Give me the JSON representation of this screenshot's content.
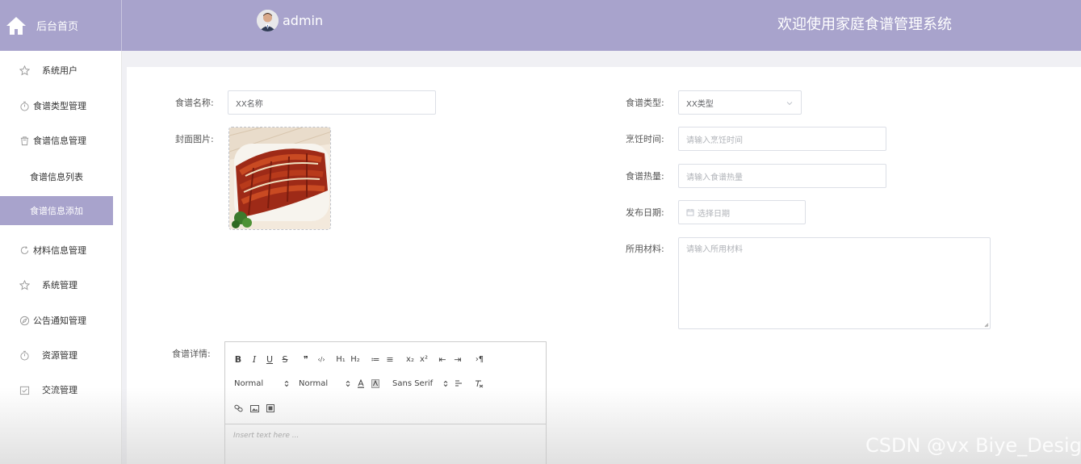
{
  "header": {
    "home_label": "后台首页",
    "username": "admin",
    "system_title": "欢迎使用家庭食谱管理系统"
  },
  "sidebar": {
    "items": [
      {
        "label": "系统用户",
        "icon": "star-icon"
      },
      {
        "label": "食谱类型管理",
        "icon": "timer-icon"
      },
      {
        "label": "食谱信息管理",
        "icon": "trash-icon"
      },
      {
        "label": "材料信息管理",
        "icon": "refresh-icon"
      },
      {
        "label": "系统管理",
        "icon": "star-icon"
      },
      {
        "label": "公告通知管理",
        "icon": "compass-icon"
      },
      {
        "label": "资源管理",
        "icon": "timer-icon"
      },
      {
        "label": "交流管理",
        "icon": "check-box-icon"
      }
    ],
    "sub_items": [
      {
        "label": "食谱信息列表",
        "active": false
      },
      {
        "label": "食谱信息添加",
        "active": true
      }
    ]
  },
  "form": {
    "name_label": "食谱名称:",
    "name_value": "XX名称",
    "cover_label": "封面图片:",
    "type_label": "食谱类型:",
    "type_value": "XX类型",
    "cook_time_label": "烹饪时间:",
    "cook_time_placeholder": "请输入烹饪时间",
    "calorie_label": "食谱热量:",
    "calorie_placeholder": "请输入食谱热量",
    "date_label": "发布日期:",
    "date_placeholder": "选择日期",
    "material_label": "所用材料:",
    "material_placeholder": "请输入所用材料",
    "detail_label": "食谱详情:"
  },
  "editor": {
    "row1": [
      "B",
      "I",
      "U",
      "S",
      "❞",
      "‹/›",
      "H₁",
      "H₂",
      "≔",
      "≡",
      "x₂",
      "x²",
      "⇤",
      "⇥",
      "›¶"
    ],
    "header_select": "Normal",
    "size_select": "Normal",
    "font_select": "Sans Serif",
    "placeholder": "Insert text here ..."
  },
  "watermark": "CSDN @vx Biye_Design",
  "colors": {
    "accent": "#a8a3cc",
    "card_bg": "#ffffff",
    "page_bg": "#f0f0f4"
  }
}
